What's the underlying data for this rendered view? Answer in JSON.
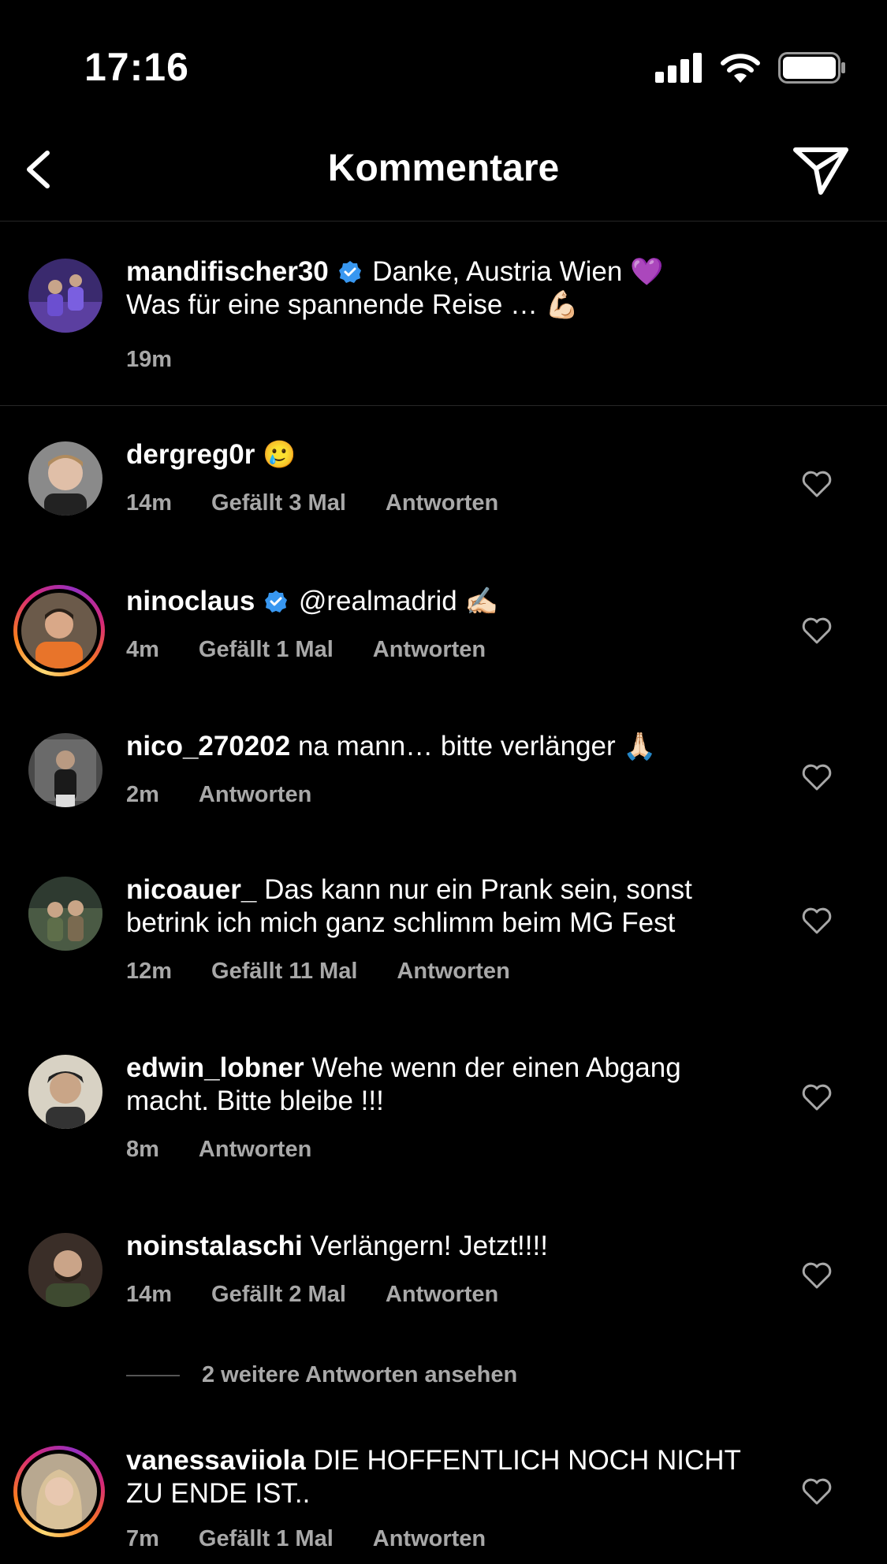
{
  "status_bar": {
    "time": "17:16"
  },
  "header": {
    "title": "Kommentare"
  },
  "caption": {
    "username": "mandifischer30",
    "verified": true,
    "text_line1": "Danke, Austria Wien",
    "emoji1": "💜",
    "text_line2": "Was für eine spannende Reise …",
    "emoji2": "💪🏻",
    "time": "19m"
  },
  "comments": [
    {
      "username": "dergreg0r",
      "text": "",
      "emoji": "🥲",
      "time": "14m",
      "likes": "Gefällt 3 Mal",
      "reply": "Antworten"
    },
    {
      "username": "ninoclaus",
      "verified": true,
      "text": "@realmadrid",
      "emoji": "✍🏻",
      "time": "4m",
      "likes": "Gefällt 1 Mal",
      "reply": "Antworten"
    },
    {
      "username": "nico_270202",
      "text": "na mann… bitte verlänger",
      "emoji": "🙏🏻",
      "time": "2m",
      "reply": "Antworten"
    },
    {
      "username": "nicoauer_",
      "text": "Das kann nur ein Prank sein, sonst betrink ich mich ganz schlimm beim MG Fest",
      "time": "12m",
      "likes": "Gefällt 11 Mal",
      "reply": "Antworten"
    },
    {
      "username": "edwin_lobner",
      "text": "Wehe wenn der einen Abgang macht. Bitte bleibe !!!",
      "time": "8m",
      "reply": "Antworten"
    },
    {
      "username": "noinstalaschi",
      "text": "Verlängern! Jetzt!!!!",
      "time": "14m",
      "likes": "Gefällt 2 Mal",
      "reply": "Antworten"
    },
    {
      "username": "vanessaviiola",
      "text": "DIE HOFFENTLICH NOCH NICHT ZU ENDE IST..",
      "time": "7m",
      "likes": "Gefällt 1 Mal",
      "reply": "Antworten"
    }
  ],
  "view_more_replies": "2 weitere Antworten ansehen",
  "colors": {
    "background": "#000000",
    "meta_text": "#a8a8a8",
    "verified_badge": "#3897f0",
    "divider": "#262626"
  }
}
